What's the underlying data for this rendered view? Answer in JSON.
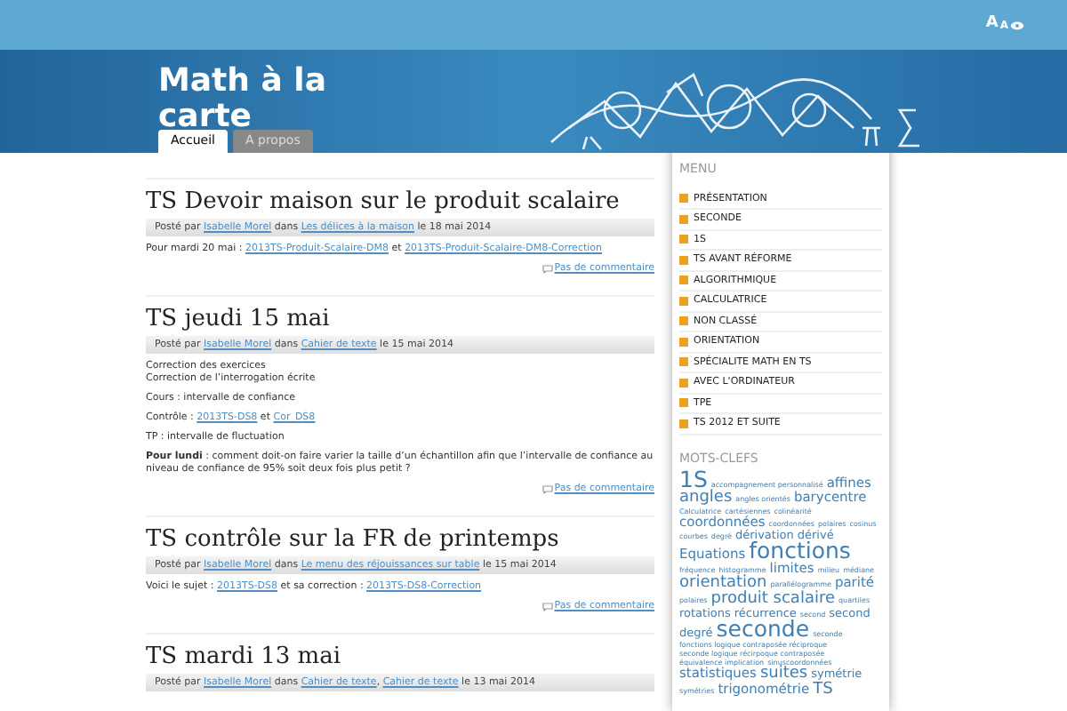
{
  "topbar": {
    "font_toggle": "A",
    "font_toggle_small": "A"
  },
  "site_title": "Math à la carte",
  "tabs": [
    {
      "label": "Accueil",
      "selected": true
    },
    {
      "label": "A propos",
      "selected": false
    }
  ],
  "posts": [
    {
      "title": "TS Devoir maison sur le produit scalaire",
      "meta": {
        "prefix": "Posté par",
        "author": "Isabelle Morel",
        "in": "dans",
        "categories": [
          "Les délices à la maison"
        ],
        "date": "le 18 mai 2014"
      },
      "paragraphs": [
        [
          [
            {
              "t": "Pour mardi 20 mai : ",
              "kind": "text"
            },
            {
              "t": "2013TS-Produit-Scalaire-DM8",
              "kind": "link"
            },
            {
              "t": " et ",
              "kind": "text"
            },
            {
              "t": "2013TS-Produit-Scalaire-DM8-Correction",
              "kind": "link"
            }
          ]
        ]
      ],
      "comments": "Pas de commentaire"
    },
    {
      "title": "TS jeudi 15 mai",
      "meta": {
        "prefix": "Posté par",
        "author": "Isabelle Morel",
        "in": "dans",
        "categories": [
          "Cahier de texte"
        ],
        "date": "le 15 mai 2014"
      },
      "paragraphs": [
        [
          [
            {
              "t": "Correction des exercices",
              "kind": "text"
            }
          ],
          [
            {
              "t": "Correction de l’interrogation écrite",
              "kind": "text"
            }
          ]
        ],
        [
          [
            {
              "t": "Cours : intervalle de confiance",
              "kind": "text"
            }
          ]
        ],
        [
          [
            {
              "t": "Contrôle : ",
              "kind": "text"
            },
            {
              "t": "2013TS-DS8",
              "kind": "link"
            },
            {
              "t": " et ",
              "kind": "text"
            },
            {
              "t": "Cor_DS8",
              "kind": "link"
            }
          ]
        ],
        [
          [
            {
              "t": "TP : intervalle de fluctuation",
              "kind": "text"
            }
          ]
        ],
        [
          [
            {
              "t": "**Pour lundi** : comment doit-on faire varier la taille d’un échantillon afin que l’intervalle de confiance au niveau de confiance de 95% soit deux fois plus petit ?",
              "kind": "text"
            }
          ]
        ]
      ],
      "comments": "Pas de commentaire"
    },
    {
      "title": "TS contrôle sur la FR de printemps",
      "meta": {
        "prefix": "Posté par",
        "author": "Isabelle Morel",
        "in": "dans",
        "categories": [
          "Le menu des réjouissances sur table"
        ],
        "date": "le 15 mai 2014"
      },
      "paragraphs": [
        [
          [
            {
              "t": "Voici le sujet : ",
              "kind": "text"
            },
            {
              "t": "2013TS-DS8",
              "kind": "link"
            },
            {
              "t": " et sa correction : ",
              "kind": "text"
            },
            {
              "t": "2013TS-DS8-Correction",
              "kind": "link"
            }
          ]
        ]
      ],
      "comments": "Pas de commentaire"
    },
    {
      "title": "TS mardi 13 mai",
      "meta": {
        "prefix": "Posté par",
        "author": "Isabelle Morel",
        "in": "dans",
        "categories": [
          "Cahier de texte",
          "Cahier de texte"
        ],
        "separator": ",",
        "date": "le 13 mai 2014"
      }
    }
  ],
  "sidebar": {
    "menu_title": "MENU",
    "menu": [
      "PRÉSENTATION",
      "SECONDE",
      "1S",
      "TS AVANT RÉFORME",
      "ALGORITHMIQUE",
      "CALCULATRICE",
      "NON CLASSÉ",
      "ORIENTATION",
      "SPÉCIALITE MATH EN TS",
      "AVEC L'ORDINATEUR",
      "TPE",
      "TS 2012 ET SUITE"
    ],
    "tags_title": "MOTS-CLEFS",
    "tags": [
      {
        "label": "1S",
        "kind": "xl"
      },
      {
        "label": "accompagnement personnalisé",
        "kind": "xs"
      },
      {
        "label": "affines",
        "kind": "m"
      },
      {
        "label": "angles",
        "kind": "l"
      },
      {
        "label": "angles orientés",
        "kind": "xs"
      },
      {
        "label": "barycentre",
        "kind": "m"
      },
      {
        "label": "Calculatrice",
        "kind": "xs"
      },
      {
        "label": "cartésiennes",
        "kind": "xs"
      },
      {
        "label": "colinéarité",
        "kind": "xs"
      },
      {
        "label": "coordonnées",
        "kind": "m"
      },
      {
        "label": "coordonnées",
        "kind": "xs"
      },
      {
        "label": "polaires",
        "kind": "xs"
      },
      {
        "label": "cosinus",
        "kind": "xs"
      },
      {
        "label": "courbes",
        "kind": "xs"
      },
      {
        "label": "degré",
        "kind": "xs"
      },
      {
        "label": "dérivation",
        "kind": "s"
      },
      {
        "label": "dérivé",
        "kind": "s"
      },
      {
        "label": "Equations",
        "kind": "m"
      },
      {
        "label": "fonctions",
        "kind": "xl"
      },
      {
        "label": "fréquence",
        "kind": "xs"
      },
      {
        "label": "histogramme",
        "kind": "xs"
      },
      {
        "label": "limites",
        "kind": "m"
      },
      {
        "label": "milieu",
        "kind": "xs"
      },
      {
        "label": "médiane",
        "kind": "xs"
      },
      {
        "label": "orientation",
        "kind": "l"
      },
      {
        "label": "parallélogramme",
        "kind": "xs"
      },
      {
        "label": "parité",
        "kind": "m"
      },
      {
        "label": "polaires",
        "kind": "xs"
      },
      {
        "label": "produit scalaire",
        "kind": "l"
      },
      {
        "label": "quartiles",
        "kind": "xs"
      },
      {
        "label": "rotations",
        "kind": "s"
      },
      {
        "label": "récurrence",
        "kind": "s"
      },
      {
        "label": "second",
        "kind": "xs"
      },
      {
        "label": "second",
        "kind": "s"
      },
      {
        "label": "degré",
        "kind": "s"
      },
      {
        "label": "seconde",
        "kind": "xl"
      },
      {
        "label": "seconde",
        "kind": "xs"
      },
      {
        "label": "fonctions logique contraposée réciproque",
        "kind": "xs"
      },
      {
        "label": "seconde logique récirpoque contraposée",
        "kind": "xs"
      },
      {
        "label": "équivalence implication",
        "kind": "xs"
      },
      {
        "label": "sinuscoordonnées",
        "kind": "xs"
      },
      {
        "label": "statistiques",
        "kind": "m"
      },
      {
        "label": "suites",
        "kind": "l"
      },
      {
        "label": "symétrie",
        "kind": "s"
      },
      {
        "label": "symétries",
        "kind": "xs"
      },
      {
        "label": "trigonométrie",
        "kind": "m"
      },
      {
        "label": "TS",
        "kind": "l"
      }
    ]
  }
}
